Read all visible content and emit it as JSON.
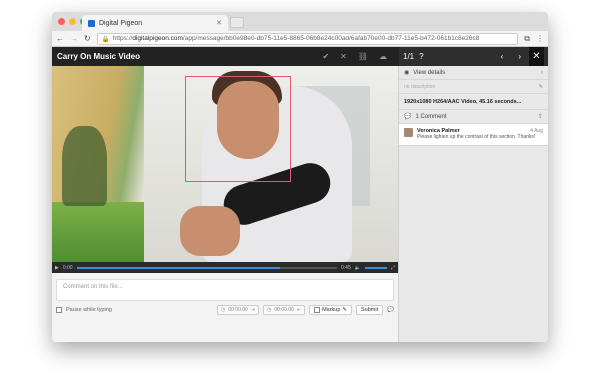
{
  "browser": {
    "tab_title": "Digital Pigeon",
    "url_prefix": "https://",
    "url_domain": "digitalpigeon.com",
    "url_path": "/app/message/bb0e98e0-db75-11e5-8865-06b8e24c00ad/6afab70e00-db77-11e5-b472-061b1c8e26c8",
    "colors": {
      "close": "#ff5f57",
      "minimize": "#febc2e",
      "maximize": "#28c840"
    }
  },
  "header": {
    "title": "Carry On Music Video",
    "pager": "1/1"
  },
  "player": {
    "progress_fraction": 0.78,
    "current_time": "0:00",
    "total_time": "0:45"
  },
  "comment_box": {
    "placeholder": "Comment on this file...",
    "pause_label": "Pause while typing",
    "time_in": "00:00.00",
    "time_out": "00:00.00",
    "markup_label": "Markup",
    "submit_label": "Submit"
  },
  "sidebar": {
    "view_details": "View details",
    "description_placeholder": "no description",
    "file_info": "1920x1080 H264/AAC Video, 45.16 seconds...",
    "comments_header": "1 Comment",
    "comments": [
      {
        "author": "Veronica Palmer",
        "date": "4 Aug",
        "text": "Please lighten up the contrast of this section. Thanks!"
      }
    ]
  }
}
